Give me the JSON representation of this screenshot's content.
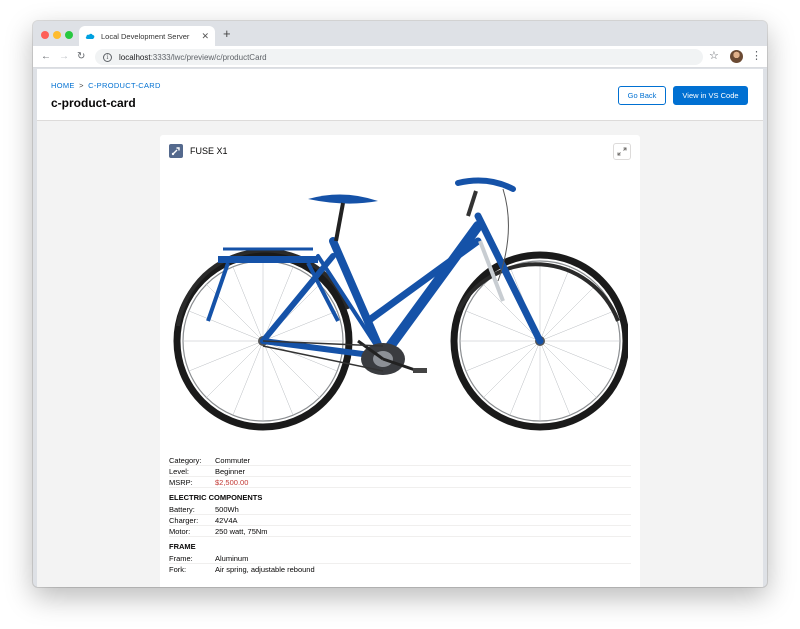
{
  "browser": {
    "tab_title": "Local Development Server",
    "new_tab_symbol": "+",
    "url_host": "localhost",
    "url_rest": ":3333/lwc/preview/c/productCard"
  },
  "header": {
    "breadcrumb_home": "HOME",
    "breadcrumb_sep": ">",
    "breadcrumb_current": "C-PRODUCT-CARD",
    "title": "c-product-card",
    "go_back_label": "Go Back",
    "vscode_label": "View in VS Code"
  },
  "product": {
    "name": "FUSE X1",
    "image_description": "blue commuter e-bike"
  },
  "details": {
    "category_label": "Category:",
    "category": "Commuter",
    "level_label": "Level:",
    "level": "Beginner",
    "msrp_label": "MSRP:",
    "msrp": "$2,500.00",
    "electric_heading": "ELECTRIC COMPONENTS",
    "battery_label": "Battery:",
    "battery": "500Wh",
    "charger_label": "Charger:",
    "charger": "42V4A",
    "motor_label": "Motor:",
    "motor": "250 watt, 75Nm",
    "frame_heading": "FRAME",
    "frame_label": "Frame:",
    "frame": "Aluminum",
    "fork_label": "Fork:",
    "fork": "Air spring, adjustable rebound"
  },
  "colors": {
    "brand": "#0070d2",
    "price": "#c23934",
    "bike_blue": "#1552a8"
  }
}
